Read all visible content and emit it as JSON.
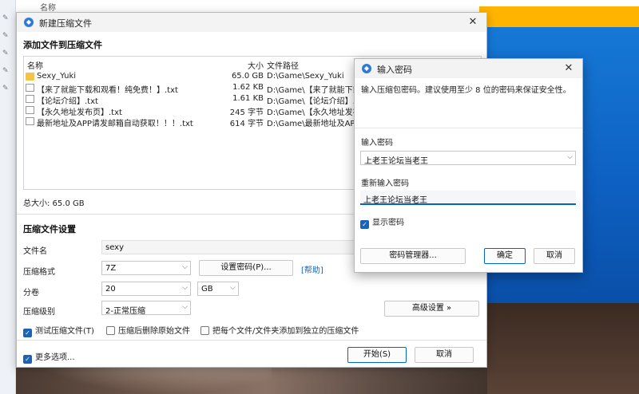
{
  "background": {
    "top_strip_label": "名称",
    "colors": {
      "accent_yellow": "#ffb400",
      "desktop_blue": "#1678d6"
    }
  },
  "main_window": {
    "title": "新建压缩文件",
    "icon": "app-icon",
    "add_files_heading": "添加文件到压缩文件",
    "columns": {
      "name": "名称",
      "size": "大小",
      "path": "文件路径"
    },
    "files": [
      {
        "icon": "folder-icon",
        "name": "Sexy_Yuki",
        "size": "65.0 GB",
        "path": "D:\\Game\\Sexy_Yuki"
      },
      {
        "icon": "file-icon",
        "name": "【来了就能下载和观看！纯免费！】.txt",
        "size": "1.62 KB",
        "path": "D:\\Game\\【来了就能下载"
      },
      {
        "icon": "file-icon",
        "name": "【论坛介绍】.txt",
        "size": "1.61 KB",
        "path": "D:\\Game\\【论坛介绍】.txt"
      },
      {
        "icon": "file-icon",
        "name": "【永久地址发布页】.txt",
        "size": "245 字节",
        "path": "D:\\Game\\【永久地址发布"
      },
      {
        "icon": "file-icon",
        "name": "最新地址及APP请发邮箱自动获取！！！.txt",
        "size": "614 字节",
        "path": "D:\\Game\\最新地址及APP"
      }
    ],
    "total_size": "总大小: 65.0 GB",
    "settings_heading": "压缩文件设置",
    "filename_label": "文件名",
    "filename_value": "sexy",
    "format_label": "压缩格式",
    "format_value": "7Z",
    "set_password_button": "设置密码(P)...",
    "help_link": "[帮助]",
    "volume_label": "分卷",
    "volume_value": "20",
    "volume_unit": "GB",
    "level_label": "压缩级别",
    "level_value": "2-正常压缩",
    "advanced_button": "高级设置 »",
    "test_archive": {
      "label": "测试压缩文件(T)",
      "checked": true
    },
    "delete_after": {
      "label": "压缩后删除原始文件",
      "checked": false
    },
    "separate_archives": {
      "label": "把每个文件/文件夹添加到独立的压缩文件",
      "checked": false
    },
    "more_options": {
      "label": "更多选项...",
      "checked": true
    },
    "start_button": "开始(S)",
    "cancel_button": "取消"
  },
  "password_dialog": {
    "title": "输入密码",
    "description": "输入压缩包密码。建议使用至少 8 位的密码来保证安全性。",
    "password_label": "输入密码",
    "password_value": "上老王论坛当老王",
    "confirm_label": "重新输入密码",
    "confirm_value": "上老王论坛当老王",
    "show_password": {
      "label": "显示密码",
      "checked": true
    },
    "manager_button": "密码管理器...",
    "ok_button": "确定",
    "cancel_button": "取消"
  }
}
